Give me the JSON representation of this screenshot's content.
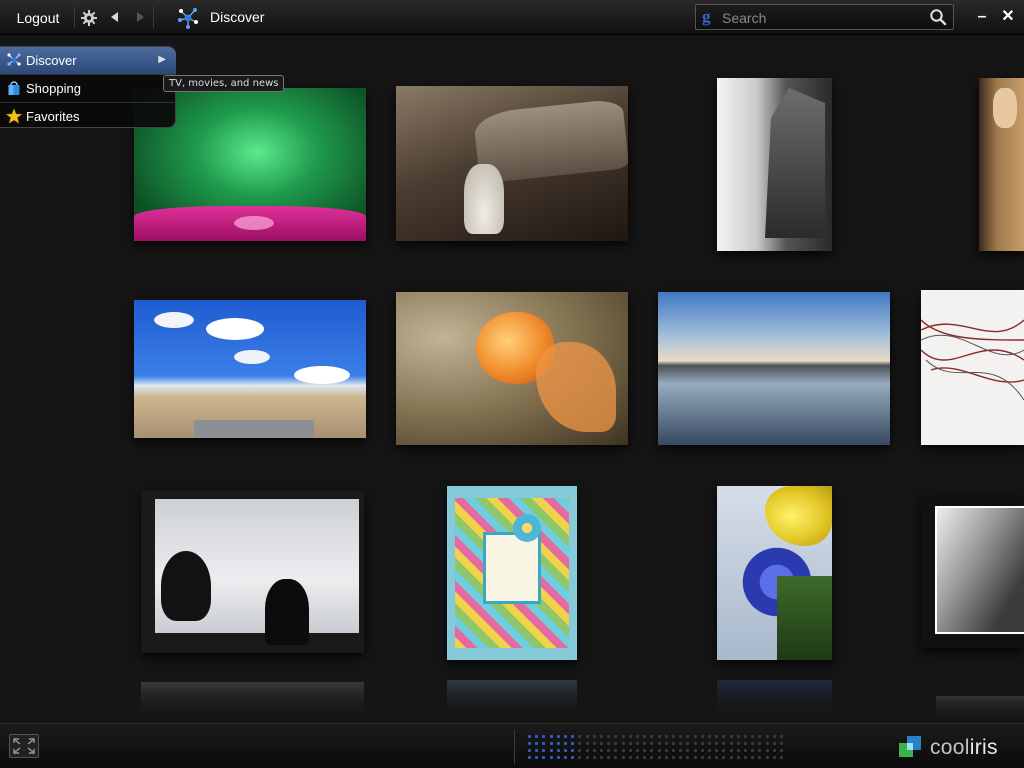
{
  "topbar": {
    "logout_label": "Logout",
    "title": "Discover",
    "search": {
      "placeholder": "Search",
      "provider_glyph": "g"
    },
    "minimize_label": "–",
    "close_label": "✕"
  },
  "menu": {
    "items": [
      {
        "label": "Discover",
        "icon": "discover-icon",
        "active": true
      },
      {
        "label": "Shopping",
        "icon": "shopping-bag-icon",
        "active": false
      },
      {
        "label": "Favorites",
        "icon": "star-icon",
        "active": false
      }
    ],
    "tooltip": "TV, movies, and news"
  },
  "brand": {
    "name_part1": "cool",
    "name_part2": "iris"
  },
  "colors": {
    "accent": "#2f5fb8",
    "menu_active": "#3d5d8f",
    "background": "#151515"
  },
  "photos": [
    {
      "subject": "green background with pink water drops"
    },
    {
      "subject": "bride in front of old airplane wreck"
    },
    {
      "subject": "ruined stone building black and white"
    },
    {
      "subject": "person in tan coat"
    },
    {
      "subject": "beach with blue sky and clouds"
    },
    {
      "subject": "orange goldfish"
    },
    {
      "subject": "calm lake reflecting sky"
    },
    {
      "subject": "abstract red and white swirls"
    },
    {
      "subject": "cat silhouette at snowy window"
    },
    {
      "subject": "handmade bird card"
    },
    {
      "subject": "blue flowers and daffodils"
    },
    {
      "subject": "black and white street scene"
    }
  ]
}
